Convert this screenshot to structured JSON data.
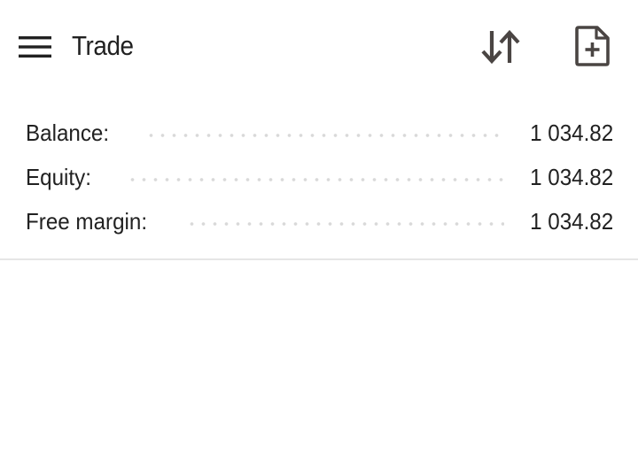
{
  "header": {
    "title": "Trade",
    "menu_icon": "hamburger-menu-icon",
    "sort_icon": "sort-arrows-icon",
    "new_order_icon": "new-document-icon"
  },
  "account": {
    "rows": [
      {
        "label": "Balance:",
        "value": "1 034.82"
      },
      {
        "label": "Equity:",
        "value": "1 034.82"
      },
      {
        "label": "Free margin:",
        "value": "1 034.82"
      }
    ]
  },
  "colors": {
    "text": "#212121",
    "icon": "#4a4543",
    "dots": "#d9d9d9",
    "divider": "#e6e6e6",
    "background": "#ffffff"
  }
}
